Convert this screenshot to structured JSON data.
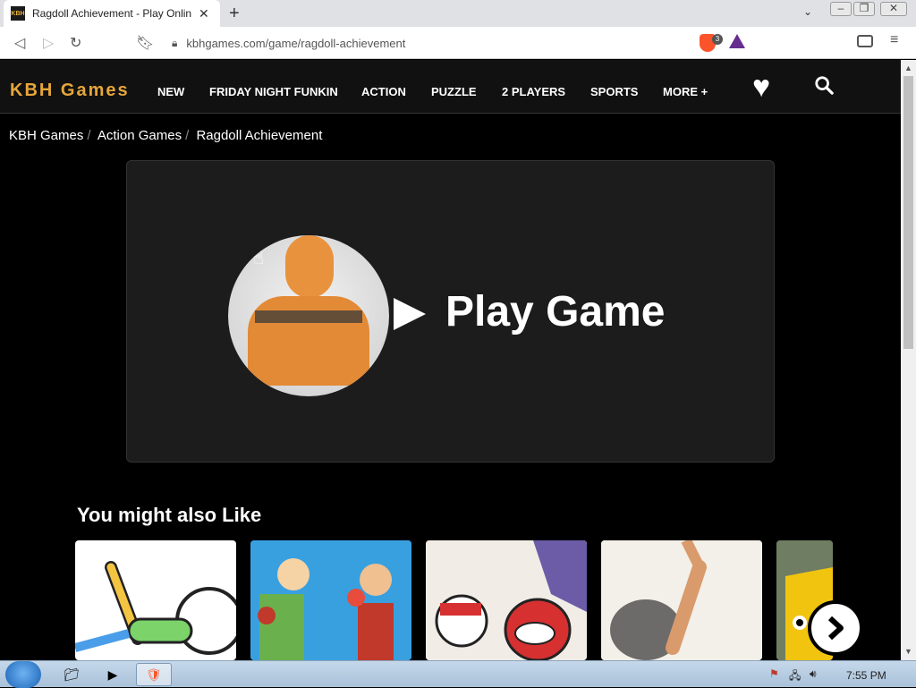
{
  "browser": {
    "tab_title": "Ragdoll Achievement - Play Onlin",
    "favicon_text": "KBH",
    "url": "kbhgames.com/game/ragdoll-achievement",
    "brave_badge": "3"
  },
  "site": {
    "logo": "KBH Games",
    "nav": [
      "NEW",
      "FRIDAY NIGHT FUNKIN",
      "ACTION",
      "PUZZLE",
      "2 PLAYERS",
      "SPORTS",
      "MORE +"
    ]
  },
  "breadcrumb": [
    "KBH Games",
    "Action Games",
    "Ragdoll Achievement"
  ],
  "player": {
    "play_label": "Play Game"
  },
  "related": {
    "title": "You might also Like"
  },
  "taskbar": {
    "clock": "7:55 PM"
  },
  "colors": {
    "brand": "#e6a63a",
    "header_bg": "#111111",
    "page_bg": "#000000",
    "player_bg": "#1c1c1c"
  }
}
